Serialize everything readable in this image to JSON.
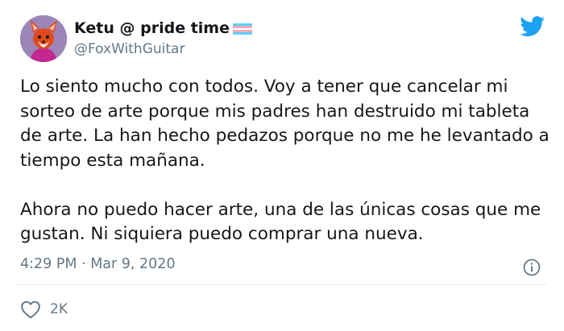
{
  "user": {
    "display_name": "Ketu @ pride time",
    "handle": "@FoxWithGuitar",
    "flag_colors": [
      "#5bcefa",
      "#f5a9b8",
      "#ffffff",
      "#f5a9b8",
      "#5bcefa"
    ]
  },
  "tweet": {
    "paragraphs": [
      "Lo siento mucho con todos. Voy a tener que cancelar mi sorteo de arte porque mis padres han destruido mi tableta de arte. La han hecho pedazos porque no me he levantado a tiempo esta mañana.",
      "Ahora no puedo hacer arte, una de las únicas cosas que me gustan. Ni siquiera puedo comprar una nueva."
    ],
    "timestamp": "4:29 PM · Mar 9, 2020",
    "like_count": "2K"
  },
  "icons": {
    "logo": "twitter-bird-icon",
    "info": "info-icon",
    "like": "heart-icon"
  },
  "colors": {
    "brand": "#1da1f2",
    "secondary_text": "#657786",
    "divider": "#e1e8ed"
  }
}
